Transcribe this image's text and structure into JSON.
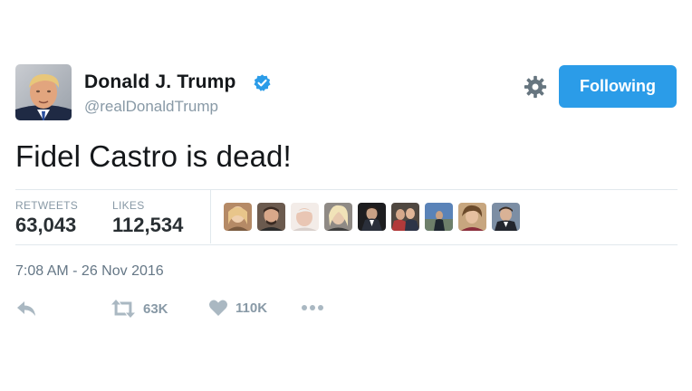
{
  "tweet": {
    "author": {
      "name": "Donald J. Trump",
      "handle": "@realDonaldTrump",
      "verified": true
    },
    "text": "Fidel Castro is dead!",
    "follow_button_label": "Following",
    "stats": {
      "retweets_label": "RETWEETS",
      "retweets_value": "63,043",
      "likes_label": "LIKES",
      "likes_value": "112,534"
    },
    "timestamp": "7:08 AM - 26 Nov 2016",
    "actions": {
      "retweet_count": "63K",
      "like_count": "110K"
    }
  },
  "icons": [
    "reply-icon",
    "retweet-icon",
    "heart-icon",
    "more-icon",
    "gear-icon",
    "verified-badge-icon"
  ],
  "colors": {
    "accent": "#2b9ce8",
    "muted": "#8899a6",
    "text": "#14171a",
    "divider": "#e1e8ed"
  }
}
